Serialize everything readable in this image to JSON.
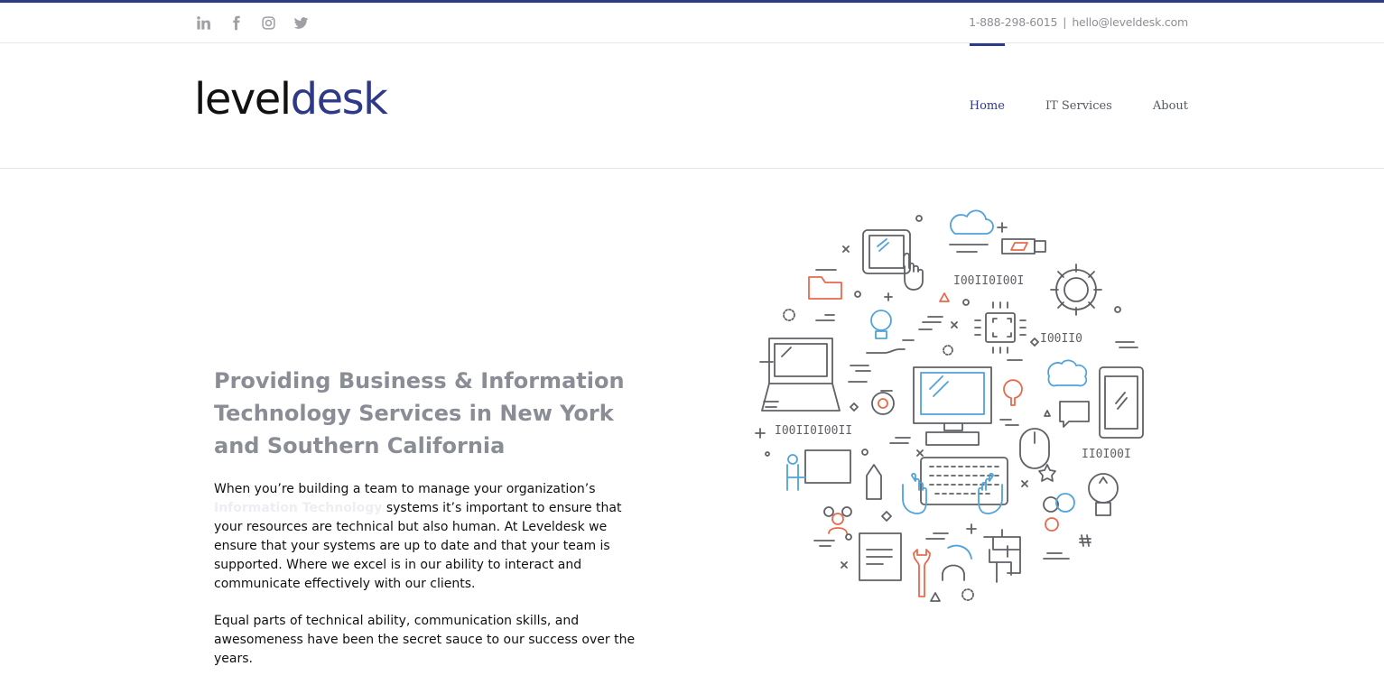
{
  "brand": {
    "accent": "#2e3a87",
    "muted": "#8a8d96",
    "orange": "#e86a4d",
    "blue": "#4fa3dc",
    "gray": "#5f6166"
  },
  "topbar": {
    "social_icons": [
      "linkedin-icon",
      "facebook-icon",
      "instagram-icon",
      "twitter-icon"
    ],
    "phone": "1-888-298-6015",
    "separator": "|",
    "email": "hello@leveldesk.com"
  },
  "header": {
    "logo_part1": "level",
    "logo_part2": "desk",
    "nav": [
      {
        "label": "Home",
        "active": true
      },
      {
        "label": "IT Services",
        "active": false
      },
      {
        "label": "About",
        "active": false
      }
    ]
  },
  "hero": {
    "title": "Providing Business & Information Technology Services in New York and Southern California",
    "para1_before": "When you’re building a team to manage your organization’s ",
    "para1_highlight": "Information Technology",
    "para1_after": " systems it’s important to ensure that your resources are technical but also human. At Leveldesk we ensure that your systems are up to date and that your team is supported. Where we excel is in our ability to interact and communicate effectively with our clients.",
    "para2": "Equal parts of technical ability, communication skills, and awesomeness have been the secret sauce to our success over the years.",
    "illustration_binary": [
      "I00II0I00I",
      "I00II0",
      "I00II0I00II",
      "II0I00I"
    ]
  }
}
